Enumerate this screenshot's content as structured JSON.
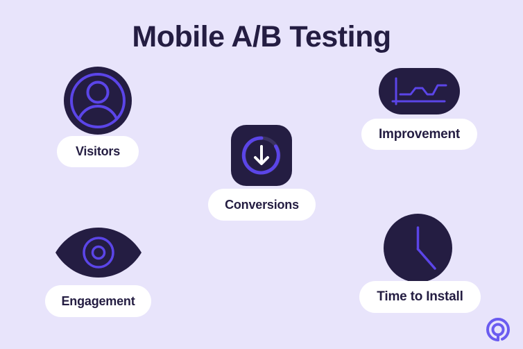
{
  "page": {
    "title": "Mobile A/B Testing",
    "background_color": "#e8e4fb",
    "dark_color": "#241d42",
    "accent_color": "#5b45e8",
    "pill_color": "#ffffff",
    "text_color": "#241d42"
  },
  "items": [
    {
      "id": "visitors",
      "label": "Visitors",
      "icon": "user-avatar-icon",
      "icon_shape": "circle"
    },
    {
      "id": "conversions",
      "label": "Conversions",
      "icon": "download-progress-icon",
      "icon_shape": "rounded-square"
    },
    {
      "id": "improvement",
      "label": "Improvement",
      "icon": "line-chart-icon",
      "icon_shape": "stadium"
    },
    {
      "id": "engagement",
      "label": "Engagement",
      "icon": "eye-icon",
      "icon_shape": "eye"
    },
    {
      "id": "time_to_install",
      "label": "Time to Install",
      "icon": "clock-icon",
      "icon_shape": "circle"
    }
  ],
  "logo": {
    "name": "brand-logo",
    "color": "#6a5bf0"
  }
}
